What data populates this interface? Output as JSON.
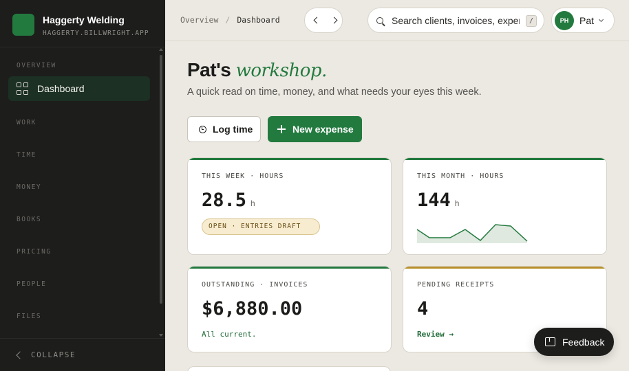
{
  "sidebar": {
    "brand_name": "Haggerty Welding",
    "brand_url": "HAGGERTY.BILLWRIGHT.APP",
    "sections": [
      "OVERVIEW",
      "WORK",
      "TIME",
      "MONEY",
      "BOOKS",
      "PRICING",
      "PEOPLE",
      "FILES"
    ],
    "active_item": "Dashboard",
    "collapse_label": "COLLAPSE"
  },
  "topbar": {
    "breadcrumb": [
      "Overview",
      "Dashboard"
    ],
    "breadcrumb_sep": "/",
    "search_placeholder": "Search clients, invoices, expenses…",
    "search_shortcut": "/",
    "user_initials": "PH",
    "user_name": "Pat"
  },
  "main": {
    "headline_prefix": "Pat's ",
    "headline_accent": "workshop.",
    "subtitle": "A quick read on time, money, and what needs your eyes this week.",
    "log_time_label": "Log time",
    "new_expense_label": "New expense"
  },
  "cards": {
    "week_hours": {
      "title": "THIS WEEK · HOURS",
      "value": "28.5",
      "unit": "h",
      "badge": "OPEN · ENTRIES DRAFT",
      "accent": "#237a3f"
    },
    "month_hours": {
      "title": "THIS MONTH · HOURS",
      "value": "144",
      "unit": "h",
      "accent": "#237a3f"
    },
    "outstanding": {
      "title": "OUTSTANDING · INVOICES",
      "value": "$6,880.00",
      "foot": "All current.",
      "accent": "#237a3f"
    },
    "receipts": {
      "title": "PENDING RECEIPTS",
      "value": "4",
      "foot": "Review →",
      "accent": "#b8902a"
    }
  },
  "feedback_label": "Feedback",
  "colors": {
    "brand": "#237a3f",
    "sidebar_bg": "#1d1d1c",
    "page_bg": "#ece9e2",
    "warning": "#b8902a"
  }
}
